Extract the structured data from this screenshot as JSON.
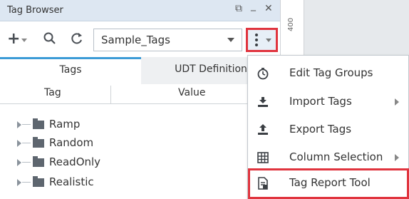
{
  "window": {
    "title": "Tag Browser",
    "restore_glyph": "⧉",
    "minimize_glyph": "_",
    "close_glyph": "✕"
  },
  "toolbar": {
    "add_glyph": "+",
    "search_glyph": "🔍",
    "refresh_glyph": "↻",
    "provider_value": "Sample_Tags"
  },
  "tabs": [
    {
      "label": "Tags",
      "active": true
    },
    {
      "label": "UDT Definition",
      "active": false
    }
  ],
  "columns": [
    "Tag",
    "Value"
  ],
  "tree": [
    {
      "label": "Ramp"
    },
    {
      "label": "Random"
    },
    {
      "label": "ReadOnly"
    },
    {
      "label": "Realistic"
    }
  ],
  "ruler": {
    "label": "400"
  },
  "menu": {
    "items": [
      {
        "label": "Edit Tag Groups",
        "icon": "clock-icon",
        "has_submenu": false,
        "highlighted": false
      },
      {
        "label": "Import Tags",
        "icon": "import-icon",
        "has_submenu": true,
        "highlighted": false
      },
      {
        "label": "Export Tags",
        "icon": "export-icon",
        "has_submenu": false,
        "highlighted": false
      },
      {
        "label": "Column Selection",
        "icon": "grid-icon",
        "has_submenu": true,
        "highlighted": false
      },
      {
        "label": "Tag Report Tool",
        "icon": "report-icon",
        "has_submenu": false,
        "highlighted": true
      }
    ]
  },
  "colors": {
    "highlight": "#e0343e",
    "accent": "#3c9bd6",
    "titlebar": "#dde7f2"
  }
}
